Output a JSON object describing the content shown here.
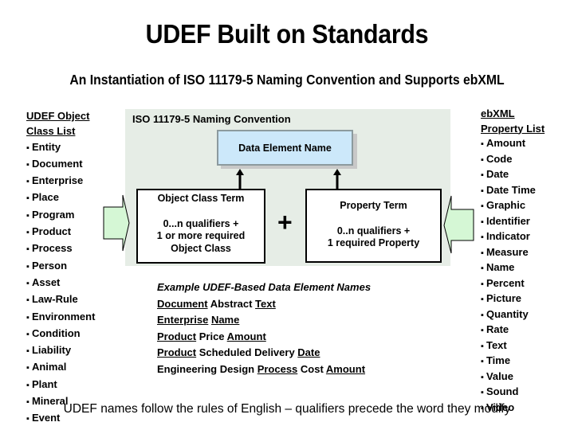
{
  "title": "UDEF Built on Standards",
  "subtitle": "An Instantiation of ISO 11179-5 Naming Convention and Supports ebXML",
  "colors": {
    "background_panel": "#e6ede6",
    "data_element_box": "#cce8fa",
    "arrow_fill": "#d5f7d5"
  },
  "object_class_list": {
    "header_line1": "UDEF Object",
    "header_line2": "Class List",
    "items": [
      "Entity",
      "Document",
      "Enterprise",
      "Place",
      "Program",
      "Product",
      "Process",
      "Person",
      "Asset",
      "Law-Rule",
      "Environment",
      "Condition",
      "Liability",
      "Animal",
      "Plant",
      "Mineral",
      "Event"
    ]
  },
  "property_list": {
    "header_line1": "ebXML",
    "header_line2": "Property List",
    "items": [
      "Amount",
      "Code",
      "Date",
      "Date Time",
      "Graphic",
      "Identifier",
      "Indicator",
      "Measure",
      "Name",
      "Percent",
      "Picture",
      "Quantity",
      "Rate",
      "Text",
      "Time",
      "Value",
      "Sound",
      "Video"
    ]
  },
  "diagram": {
    "panel_label": "ISO 11179-5 Naming Convention",
    "data_element_name": "Data Element Name",
    "object_class_term": {
      "title": "Object Class Term",
      "line1": "0...n qualifiers +",
      "line2": "1 or more required",
      "line3": "Object Class"
    },
    "plus_sign": "+",
    "property_term": {
      "title": "Property Term",
      "line1": "0..n qualifiers +",
      "line2": "1 required Property"
    }
  },
  "examples": {
    "title": "Example UDEF-Based Data Element Names",
    "rows": [
      [
        {
          "t": "Document",
          "u": true
        },
        {
          "t": " Abstract ",
          "u": false
        },
        {
          "t": "Text",
          "u": true
        }
      ],
      [
        {
          "t": "Enterprise",
          "u": true
        },
        {
          "t": " ",
          "u": false
        },
        {
          "t": "Name",
          "u": true
        }
      ],
      [
        {
          "t": "Product",
          "u": true
        },
        {
          "t": " Price ",
          "u": false
        },
        {
          "t": "Amount",
          "u": true
        }
      ],
      [
        {
          "t": "Product",
          "u": true
        },
        {
          "t": " Scheduled Delivery ",
          "u": false
        },
        {
          "t": "Date",
          "u": true
        }
      ],
      [
        {
          "t": "Engineering Design ",
          "u": false
        },
        {
          "t": "Process",
          "u": true
        },
        {
          "t": " Cost ",
          "u": false
        },
        {
          "t": "Amount",
          "u": true
        }
      ]
    ]
  },
  "footer": "UDEF names follow the rules of English – qualifiers precede the word they modify"
}
